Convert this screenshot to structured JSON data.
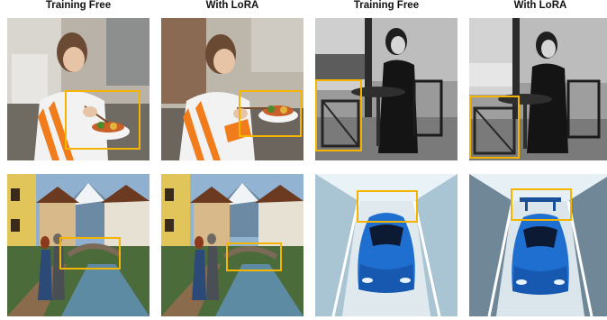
{
  "columns": [
    {
      "label": "Training Free"
    },
    {
      "label": "With LoRA"
    },
    {
      "label": "Training Free"
    },
    {
      "label": "With LoRA"
    }
  ],
  "highlight_color": "#f5b400",
  "panels": [
    {
      "row": 1,
      "col": 1,
      "scene": "woman in kitchen holding chopsticks over salad bowl",
      "variant": "training-free"
    },
    {
      "row": 1,
      "col": 2,
      "scene": "woman in kitchen holding chopsticks over salad bowl",
      "variant": "lora"
    },
    {
      "row": 1,
      "col": 3,
      "scene": "black-and-white woman seated at cafe table with chairs",
      "variant": "training-free"
    },
    {
      "row": 1,
      "col": 4,
      "scene": "black-and-white woman seated at cafe table with chairs",
      "variant": "lora"
    },
    {
      "row": 2,
      "col": 1,
      "scene": "couple on alpine village path beside river and bridge",
      "variant": "training-free"
    },
    {
      "row": 2,
      "col": 2,
      "scene": "couple on alpine village path beside river and bridge",
      "variant": "lora"
    },
    {
      "row": 2,
      "col": 3,
      "scene": "blue sports car driving through light tunnel",
      "variant": "training-free"
    },
    {
      "row": 2,
      "col": 4,
      "scene": "blue sports car with rear wing driving through light tunnel",
      "variant": "lora"
    }
  ]
}
